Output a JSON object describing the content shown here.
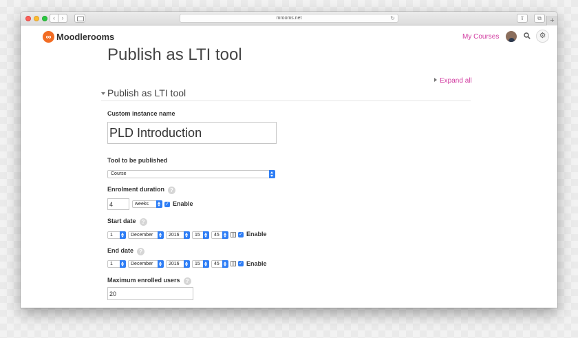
{
  "browser": {
    "url": "mrooms.net",
    "nav_back": "‹",
    "nav_forward": "›",
    "reload": "↻",
    "share": "⇪",
    "tabs": "⧉",
    "new_tab": "+"
  },
  "header": {
    "logo_text": "Moodlerooms",
    "logo_mark": "∞",
    "my_courses": "My Courses",
    "accent_color": "#d13ba0",
    "brand_color": "#f26c23"
  },
  "page": {
    "title": "Publish as LTI tool",
    "expand_all": "Expand all",
    "section_title": "Publish as LTI tool"
  },
  "form": {
    "instance_name_label": "Custom instance name",
    "instance_name_value": "PLD Introduction",
    "tool_label": "Tool to be published",
    "tool_value": "Course",
    "enrolment_label": "Enrolment duration",
    "enrolment_value": "4",
    "enrolment_unit": "weeks",
    "enable_label": "Enable",
    "start_label": "Start date",
    "start": {
      "day": "1",
      "month": "December",
      "year": "2016",
      "hour": "15",
      "minute": "45"
    },
    "end_label": "End date",
    "end": {
      "day": "1",
      "month": "December",
      "year": "2016",
      "hour": "15",
      "minute": "45"
    },
    "max_users_label": "Maximum enrolled users",
    "max_users_value": "20",
    "help": "?",
    "check": "✓"
  }
}
